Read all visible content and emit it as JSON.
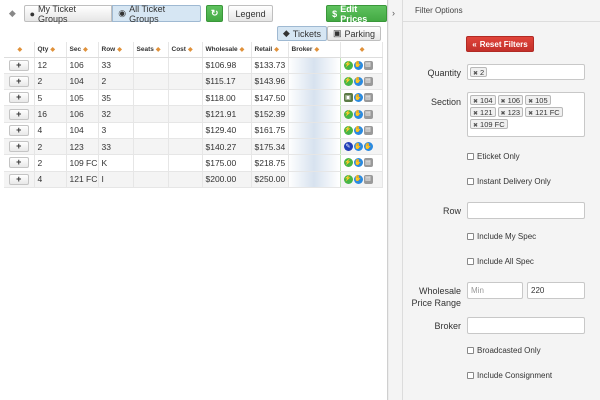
{
  "toolbar": {
    "my_groups": "My Ticket Groups",
    "all_groups": "All Ticket Groups",
    "legend": "Legend",
    "edit_prices": "Edit Prices"
  },
  "tabs": {
    "tickets": "Tickets",
    "parking": "Parking"
  },
  "columns": [
    "Qty",
    "Sec",
    "Row",
    "Seats",
    "Cost",
    "Wholesale",
    "Retail",
    "Broker"
  ],
  "rows": [
    {
      "qty": "12",
      "sec": "106",
      "row": "33",
      "seats": "",
      "cost": "",
      "wholesale": "$106.98",
      "retail": "$133.73",
      "icons": [
        "g",
        "b",
        "gr"
      ]
    },
    {
      "qty": "2",
      "sec": "104",
      "row": "2",
      "seats": "",
      "cost": "",
      "wholesale": "$115.17",
      "retail": "$143.96",
      "icons": [
        "g",
        "b",
        "gr"
      ]
    },
    {
      "qty": "5",
      "sec": "105",
      "row": "35",
      "seats": "",
      "cost": "",
      "wholesale": "$118.00",
      "retail": "$147.50",
      "icons": [
        "dk",
        "b",
        "gr"
      ]
    },
    {
      "qty": "16",
      "sec": "106",
      "row": "32",
      "seats": "",
      "cost": "",
      "wholesale": "$121.91",
      "retail": "$152.39",
      "icons": [
        "g",
        "b",
        "gr"
      ]
    },
    {
      "qty": "4",
      "sec": "104",
      "row": "3",
      "seats": "",
      "cost": "",
      "wholesale": "$129.40",
      "retail": "$161.75",
      "icons": [
        "g",
        "b",
        "gr"
      ]
    },
    {
      "qty": "2",
      "sec": "123",
      "row": "33",
      "seats": "",
      "cost": "",
      "wholesale": "$140.27",
      "retail": "$175.34",
      "icons": [
        "db",
        "b",
        "b"
      ]
    },
    {
      "qty": "2",
      "sec": "109 FC",
      "row": "K",
      "seats": "",
      "cost": "",
      "wholesale": "$175.00",
      "retail": "$218.75",
      "icons": [
        "g",
        "b",
        "gr"
      ]
    },
    {
      "qty": "4",
      "sec": "121 FC",
      "row": "I",
      "seats": "",
      "cost": "",
      "wholesale": "$200.00",
      "retail": "$250.00",
      "icons": [
        "g",
        "b",
        "gr"
      ]
    }
  ],
  "filters": {
    "title": "Filter Options",
    "reset": "Reset Filters",
    "quantity_label": "Quantity",
    "quantity_chips": [
      "2"
    ],
    "section_label": "Section",
    "section_chips": [
      "104",
      "106",
      "105",
      "121",
      "123",
      "121 FC",
      "109 FC"
    ],
    "eticket_only": "Eticket Only",
    "instant_delivery": "Instant Delivery Only",
    "row_label": "Row",
    "include_my_spec": "Include My Spec",
    "include_all_spec": "Include All Spec",
    "wholesale_label": "Wholesale Price Range",
    "min_placeholder": "Min",
    "max_value": "220",
    "broker_label": "Broker",
    "broadcasted_only": "Broadcasted Only",
    "include_consignment": "Include Consignment"
  },
  "colors": {
    "green": "#46b646",
    "blue": "#2a8ae0",
    "red": "#d23a32"
  }
}
